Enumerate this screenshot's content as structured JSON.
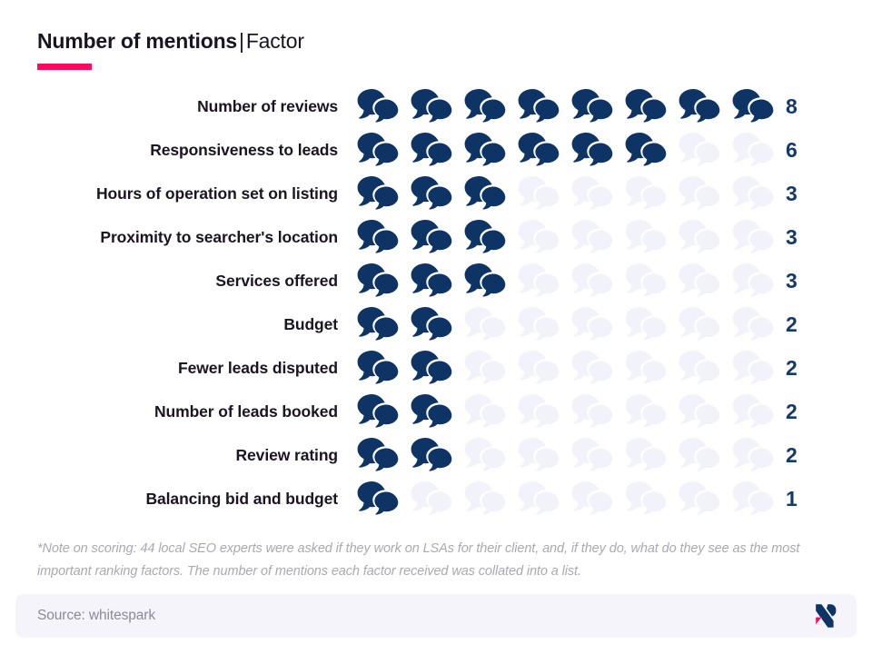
{
  "header": {
    "title_strong": "Number of mentions",
    "title_separator": "|",
    "title_light": "Factor"
  },
  "footnote": "*Note on scoring: 44 local SEO experts were asked if they work on LSAs for their client, and, if they do, what do they see as the most important ranking factors. The number of mentions each factor received was collated into a list.",
  "footer": {
    "source": "Source: whitespark",
    "logo": "brandmark-logo"
  },
  "colors": {
    "filled_icon": "#0d3464",
    "empty_icon": "#f2f2fa",
    "value_text": "#123a6b",
    "label_text": "#1a1423",
    "accent": "#fb0a5f",
    "footnote_text": "#a9a9b4",
    "footer_bg": "#f5f4fb"
  },
  "chart_data": {
    "type": "bar",
    "subtype": "pictogram",
    "title": "Number of mentions | Factor",
    "xlabel": "Number of mentions",
    "ylabel": "Factor",
    "icon": "speech-bubbles-icon",
    "icon_unit_value": 1,
    "max_icons_per_row": 8,
    "xlim": [
      0,
      8
    ],
    "grid": false,
    "legend": false,
    "categories": [
      "Number of reviews",
      "Responsiveness to leads",
      "Hours of operation set on listing",
      "Proximity to searcher's location",
      "Services offered",
      "Budget",
      "Fewer leads disputed",
      "Number of leads booked",
      "Review rating",
      "Balancing bid and budget"
    ],
    "values": [
      8,
      6,
      3,
      3,
      3,
      2,
      2,
      2,
      2,
      1
    ]
  }
}
